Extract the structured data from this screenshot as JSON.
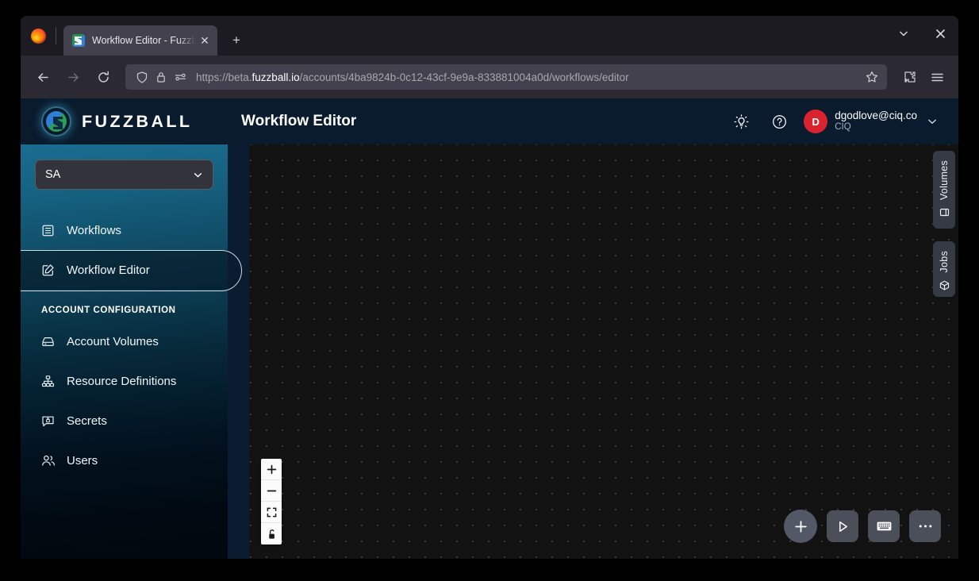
{
  "browser": {
    "firefox_logo": "firefox-logo",
    "tab": {
      "title": "Workflow Editor - Fuzzball",
      "favicon": "fuzzball-favicon",
      "close_label": "✕"
    },
    "new_tab_label": "+",
    "window": {
      "list_tabs_label": "⌄",
      "close_label": "✕"
    },
    "nav": {
      "back_label": "←",
      "forward_label": "→",
      "reload_label": "↻"
    },
    "url": {
      "scheme": "https://beta.",
      "host": "fuzzball.io",
      "path": "/accounts/4ba9824b-0c12-43cf-9e9a-833881004a0d/workflows/editor",
      "full": "https://beta.fuzzball.io/accounts/4ba9824b-0c12-43cf-9e9a-833881004a0d/workflows/editor",
      "shield_icon": "tracking-protection-shield-icon",
      "lock_icon": "padlock-icon",
      "permissions_icon": "site-permissions-icon",
      "bookmark_icon": "star-bookmark-icon"
    },
    "toolbar": {
      "extensions_label": "extensions-puzzle-icon",
      "menu_label": "hamburger-menu-icon"
    }
  },
  "app": {
    "brand": "FUZZBALL",
    "page_title": "Workflow Editor",
    "header": {
      "theme_icon": "lightbulb-icon",
      "help_icon": "question-circle-icon",
      "avatar_initial": "D",
      "user_email": "dgodlove@ciq.co",
      "user_org": "CIQ",
      "caret": "⌄"
    },
    "sidebar": {
      "org_selector": {
        "value": "SA",
        "caret": "⌄"
      },
      "primary_items": [
        {
          "label": "Workflows",
          "icon": "list-box-icon",
          "active": false
        },
        {
          "label": "Workflow Editor",
          "icon": "pencil-square-icon",
          "active": true
        }
      ],
      "section_label": "ACCOUNT CONFIGURATION",
      "config_items": [
        {
          "label": "Account Volumes",
          "icon": "drive-icon"
        },
        {
          "label": "Resource Definitions",
          "icon": "hierarchy-icon"
        },
        {
          "label": "Secrets",
          "icon": "secret-lock-icon"
        },
        {
          "label": "Users",
          "icon": "users-icon"
        }
      ]
    },
    "side_tabs": [
      {
        "label": "Volumes",
        "icon": "volume-cylinder-icon"
      },
      {
        "label": "Jobs",
        "icon": "cube-icon"
      }
    ],
    "zoom_controls": [
      {
        "name": "zoom-in",
        "icon": "plus-icon"
      },
      {
        "name": "zoom-out",
        "icon": "minus-icon"
      },
      {
        "name": "fit-view",
        "icon": "fit-frame-icon"
      },
      {
        "name": "toggle-interactivity",
        "icon": "lock-icon"
      }
    ],
    "actions": [
      {
        "name": "add-node-button",
        "icon": "plus-icon"
      },
      {
        "name": "run-workflow-button",
        "icon": "play-icon"
      },
      {
        "name": "editor-keyboard-button",
        "icon": "keyboard-icon"
      },
      {
        "name": "more-options-button",
        "icon": "ellipsis-icon"
      }
    ],
    "colors": {
      "brand_navy": "#0a1b2e",
      "sidebar_top": "#1a6d91",
      "sidebar_bottom": "#01080f",
      "canvas_bg": "#121212",
      "canvas_dot": "#3b3b3b",
      "avatar_red": "#d9232e",
      "action_gray": "#4a4f5a"
    }
  }
}
